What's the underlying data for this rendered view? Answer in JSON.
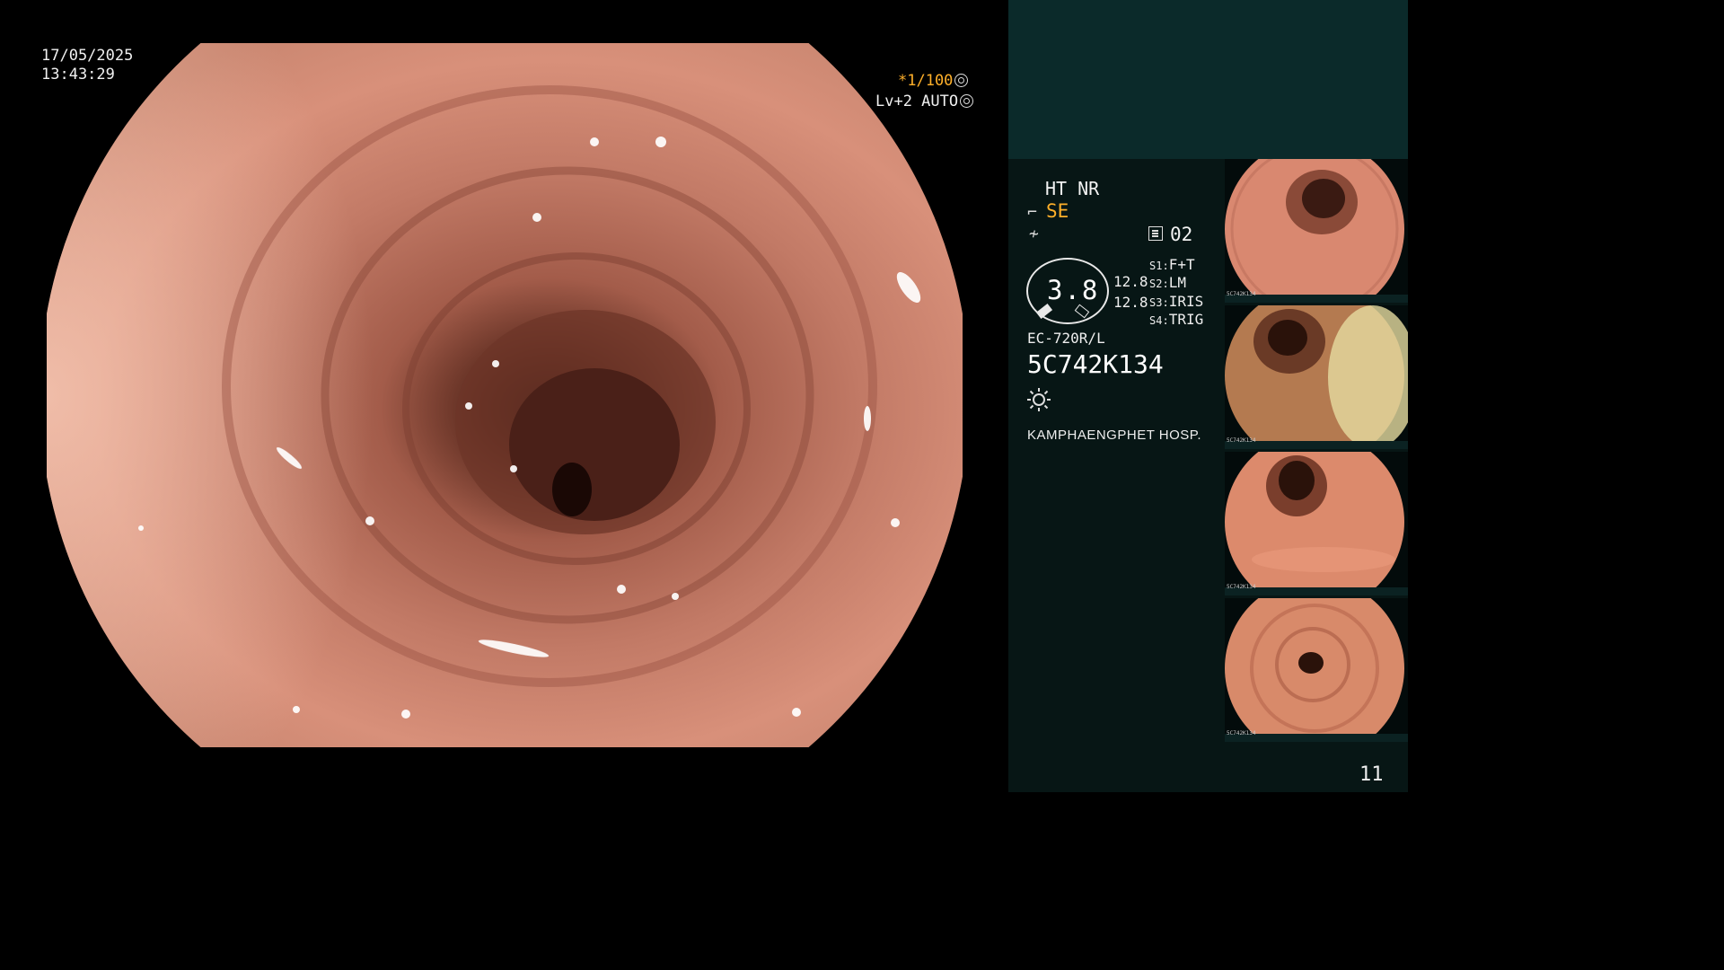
{
  "overlay": {
    "date": "17/05/2025",
    "time": "13:43:29",
    "shutter": "*1/100",
    "level": "Lv+2 AUTO"
  },
  "panel": {
    "ht_nr": "HT NR",
    "se": "SE",
    "memory": "02",
    "gauge_value": "3.8",
    "value_1": "12.8",
    "value_2": "12.8",
    "settings": [
      {
        "label": "S1:",
        "value": "F+T"
      },
      {
        "label": "S2:",
        "value": "LM"
      },
      {
        "label": "S3:",
        "value": "IRIS"
      },
      {
        "label": "S4:",
        "value": "TRIG"
      }
    ],
    "model": "EC-720R/L",
    "serial": "5C742K134",
    "hospital": "KAMPHAENGPHET HOSP.",
    "page_number": "11"
  },
  "thumbnails": [
    {
      "label": "5C742K134"
    },
    {
      "label": "5C742K134"
    },
    {
      "label": "5C742K134"
    },
    {
      "label": "5C742K134"
    }
  ],
  "colors": {
    "accent": "#ffb02a",
    "panel_top": "#0b2a2a",
    "panel": "#071615",
    "mucosa": "#c97a66"
  }
}
